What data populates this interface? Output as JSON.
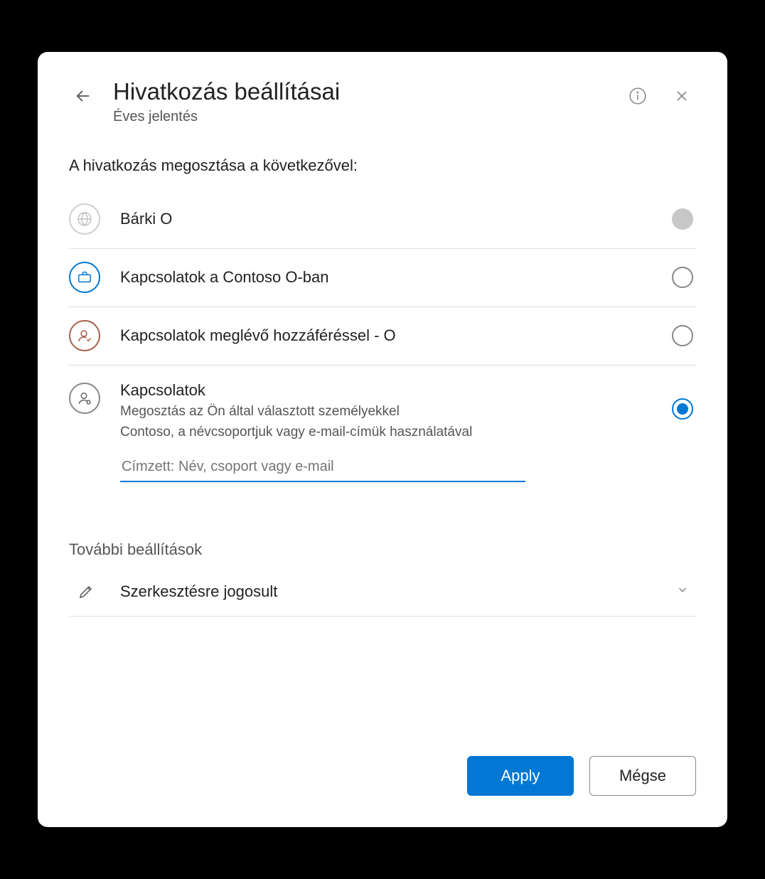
{
  "header": {
    "title": "Hivatkozás beállításai",
    "subtitle": "Éves jelentés"
  },
  "share": {
    "section_label": "A hivatkozás megosztása a következővel:",
    "options": [
      {
        "label": "Bárki O",
        "state": "disabled"
      },
      {
        "label": "Kapcsolatok a Contoso O-ban",
        "state": "unselected"
      },
      {
        "label": "Kapcsolatok meglévő hozzáféréssel - O",
        "state": "unselected"
      },
      {
        "label": "Kapcsolatok",
        "state": "selected",
        "sub1": "Megosztás az Ön által választott személyekkel",
        "sub2": "Contoso, a névcsoportjuk vagy e-mail-címük használatával"
      }
    ],
    "recipient_placeholder": "Címzett: Név, csoport vagy e-mail"
  },
  "more": {
    "title": "További beállítások",
    "permission_label": "Szerkesztésre jogosult"
  },
  "footer": {
    "apply": "Apply",
    "cancel": "Mégse"
  }
}
